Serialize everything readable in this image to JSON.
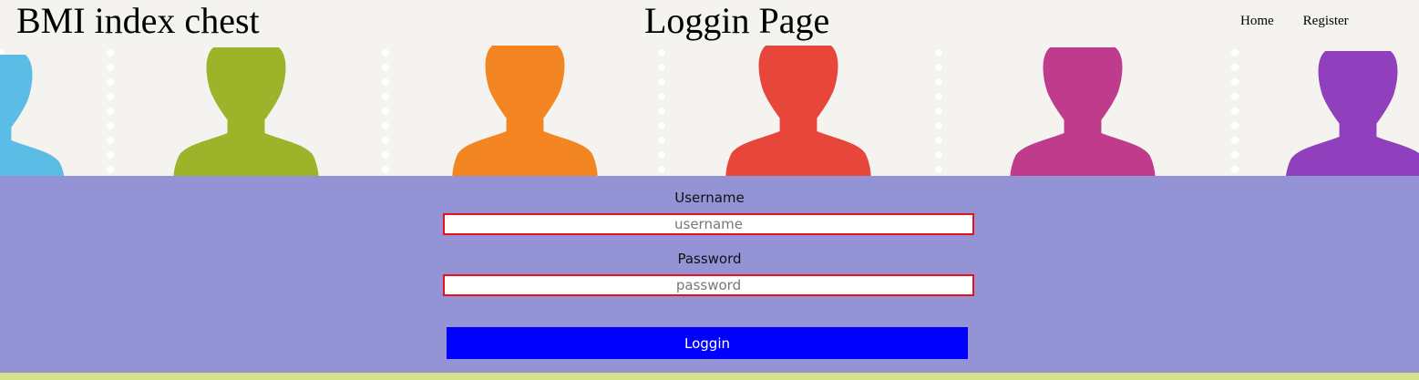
{
  "header": {
    "site_title": "BMI index chest",
    "page_title": "Loggin Page",
    "nav": [
      {
        "label": "Home"
      },
      {
        "label": "Register"
      }
    ]
  },
  "banner": {
    "silhouette_colors": [
      "#5bbde6",
      "#9cb32a",
      "#f48523",
      "#e6473a",
      "#bf3b8c",
      "#9040bd"
    ]
  },
  "form": {
    "username_label": "Username",
    "username_placeholder": "username",
    "username_value": "",
    "password_label": "Password",
    "password_placeholder": "password",
    "password_value": "",
    "login_label": "Loggin"
  },
  "colors": {
    "form_background": "#9393d6",
    "input_border": "#e8101b",
    "button_background": "#0000ff",
    "footer_strip": "#d4e38a"
  }
}
